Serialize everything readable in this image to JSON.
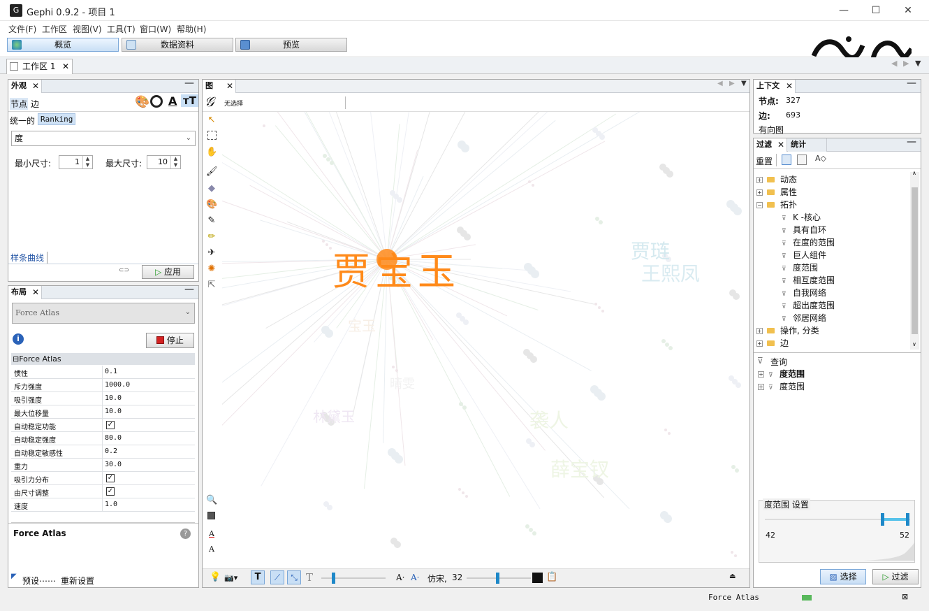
{
  "window": {
    "title": "Gephi 0.9.2 - 项目 1",
    "app_icon_glyph": "G"
  },
  "menu": [
    "文件(F)",
    "工作区",
    "视图(V)",
    "工具(T)",
    "窗口(W)",
    "帮助(H)"
  ],
  "main_tabs": [
    "概览",
    "数据资料",
    "预览"
  ],
  "workspace_tab": "工作区 1",
  "appearance": {
    "tab_title": "外观",
    "subtabs": [
      "节点",
      "边"
    ],
    "modes": [
      "统一的",
      "Ranking"
    ],
    "attribute": "度",
    "min_size_label": "最小尺寸:",
    "min_size": "1",
    "max_size_label": "最大尺寸:",
    "max_size": "10",
    "spline_label": "样条曲线",
    "apply_label": "应用"
  },
  "layout": {
    "tab_title": "布局",
    "algorithm": "Force Atlas",
    "stop_label": "停止",
    "section_title": "Force Atlas",
    "properties": [
      {
        "name": "惯性",
        "value": "0.1"
      },
      {
        "name": "斥力强度",
        "value": "1000.0"
      },
      {
        "name": "吸引强度",
        "value": "10.0"
      },
      {
        "name": "最大位移量",
        "value": "10.0"
      },
      {
        "name": "自动稳定功能",
        "value": "✓"
      },
      {
        "name": "自动稳定强度",
        "value": "80.0"
      },
      {
        "name": "自动稳定敏感性",
        "value": "0.2"
      },
      {
        "name": "重力",
        "value": "30.0"
      },
      {
        "name": "吸引力分布",
        "value": "✓"
      },
      {
        "name": "由尺寸调整",
        "value": "✓"
      },
      {
        "name": "速度",
        "value": "1.0"
      }
    ],
    "description_title": "Force Atlas",
    "presets_label": "预设⋯⋯",
    "reset_label": "重新设置"
  },
  "graph": {
    "tab_title": "图",
    "selection_text": "无选择",
    "labels": [
      "贾",
      "宝",
      "玉"
    ],
    "faint_labels": [
      "贾琏",
      "王熙凤",
      "袭人",
      "薛宝钗",
      "林黛玉",
      "晴雯",
      "宝玉"
    ],
    "font_name": "仿宋,",
    "font_size": "32"
  },
  "context": {
    "tab_title": "上下文",
    "nodes_label": "节点:",
    "nodes": "327",
    "edges_label": "边:",
    "edges": "693",
    "graph_type": "有向图"
  },
  "filters": {
    "tabs": [
      "过滤",
      "统计"
    ],
    "reset_label": "重置",
    "tree": [
      {
        "label": "动态",
        "type": "folder"
      },
      {
        "label": "属性",
        "type": "folder"
      },
      {
        "label": "拓扑",
        "type": "folder-open"
      },
      {
        "label": "K -核心",
        "type": "filter"
      },
      {
        "label": "具有自环",
        "type": "filter"
      },
      {
        "label": "在度的范围",
        "type": "filter"
      },
      {
        "label": "巨人组件",
        "type": "filter"
      },
      {
        "label": "度范围",
        "type": "filter"
      },
      {
        "label": "相互度范围",
        "type": "filter"
      },
      {
        "label": "自我网络",
        "type": "filter"
      },
      {
        "label": "超出度范围",
        "type": "filter"
      },
      {
        "label": "邻居网络",
        "type": "filter"
      },
      {
        "label": "操作, 分类",
        "type": "folder"
      },
      {
        "label": "边",
        "type": "folder"
      }
    ],
    "queries_label": "查询",
    "queries": [
      "度范围",
      "度范围"
    ],
    "settings_title": "度范围 设置",
    "range_min": "42",
    "range_max": "52",
    "select_label": "选择",
    "filter_label": "过滤"
  },
  "statusbar": {
    "layout_name": "Force Atlas"
  },
  "colors": {
    "accent": "#ff8a1a",
    "selected_tab": "#c9dff5",
    "slider": "#1e88c8"
  }
}
